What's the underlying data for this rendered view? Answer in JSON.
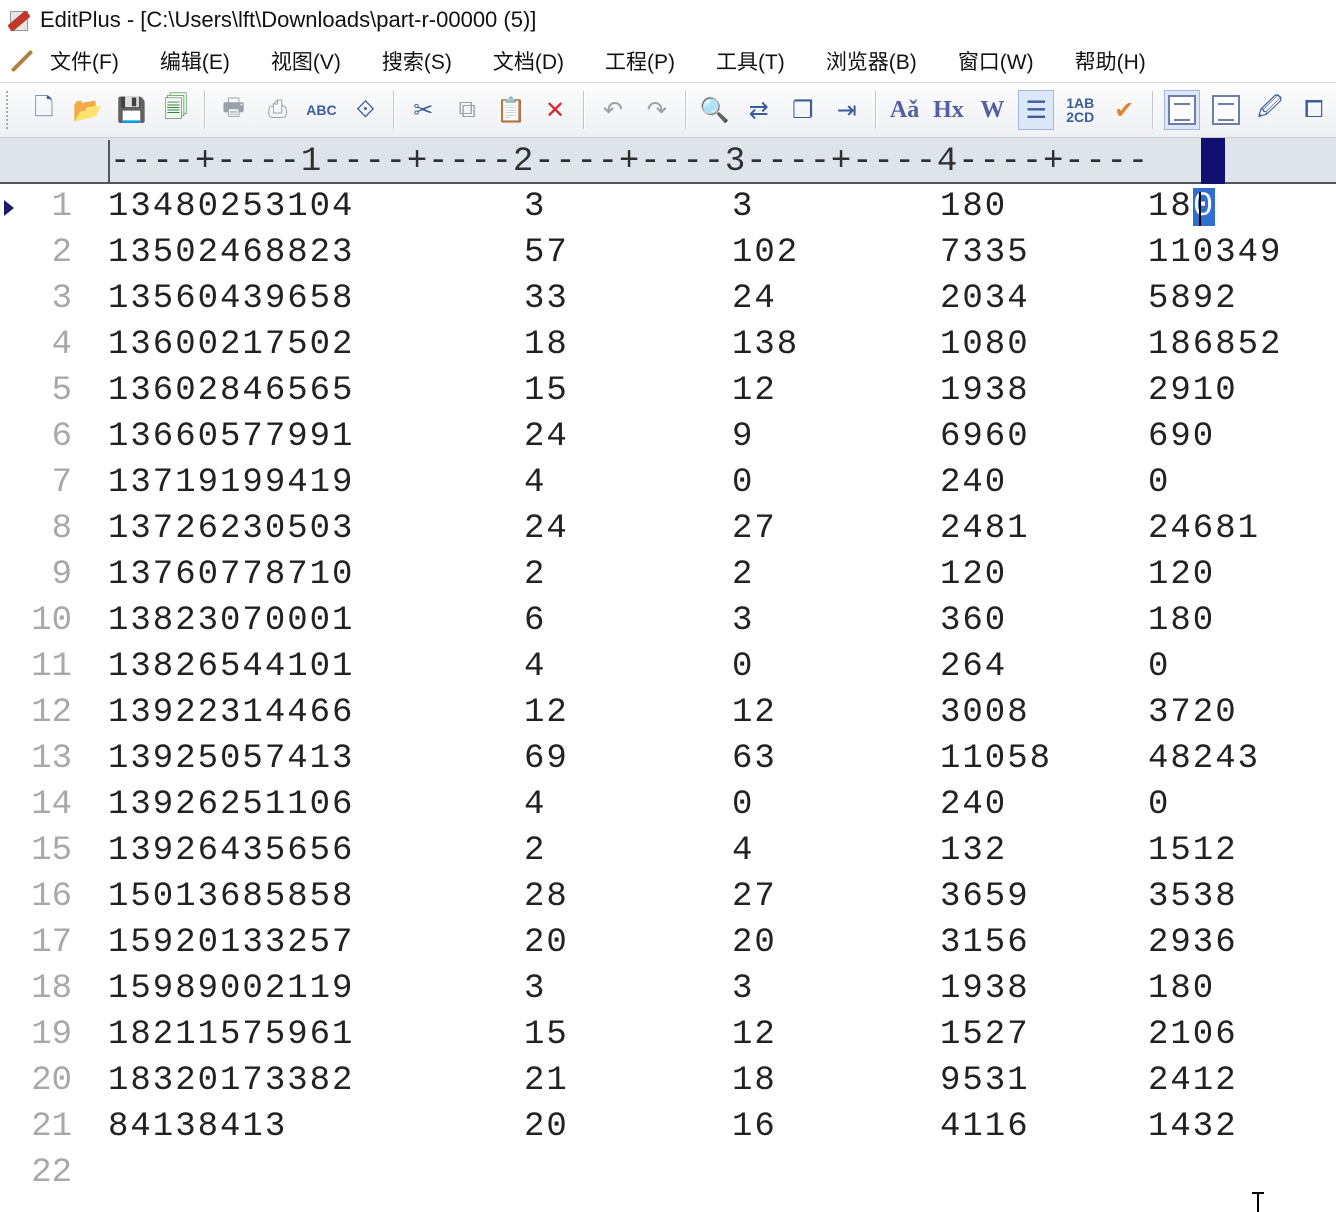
{
  "window": {
    "title": "EditPlus - [C:\\Users\\lft\\Downloads\\part-r-00000 (5)]"
  },
  "menu": {
    "items": [
      "文件(F)",
      "编辑(E)",
      "视图(V)",
      "搜索(S)",
      "文档(D)",
      "工程(P)",
      "工具(T)",
      "浏览器(B)",
      "窗口(W)",
      "帮助(H)"
    ]
  },
  "toolbar": {
    "spell_label": "ABC",
    "font_label": "Aǎ",
    "hex_label": "Hx",
    "word_label": "W",
    "col_label": "1AB\n2CD"
  },
  "ruler": {
    "text": "----+----1----+----2----+----3----+----4----+----"
  },
  "editor": {
    "rows": [
      {
        "num": "1",
        "cols": [
          "13480253104",
          "3",
          "3",
          "180",
          "180"
        ]
      },
      {
        "num": "2",
        "cols": [
          "13502468823",
          "57",
          "102",
          "7335",
          "110349"
        ]
      },
      {
        "num": "3",
        "cols": [
          "13560439658",
          "33",
          "24",
          "2034",
          "5892"
        ]
      },
      {
        "num": "4",
        "cols": [
          "13600217502",
          "18",
          "138",
          "1080",
          "186852"
        ]
      },
      {
        "num": "5",
        "cols": [
          "13602846565",
          "15",
          "12",
          "1938",
          "2910"
        ]
      },
      {
        "num": "6",
        "cols": [
          "13660577991",
          "24",
          "9",
          "6960",
          "690"
        ]
      },
      {
        "num": "7",
        "cols": [
          "13719199419",
          "4",
          "0",
          "240",
          "0"
        ]
      },
      {
        "num": "8",
        "cols": [
          "13726230503",
          "24",
          "27",
          "2481",
          "24681"
        ]
      },
      {
        "num": "9",
        "cols": [
          "13760778710",
          "2",
          "2",
          "120",
          "120"
        ]
      },
      {
        "num": "10",
        "cols": [
          "13823070001",
          "6",
          "3",
          "360",
          "180"
        ]
      },
      {
        "num": "11",
        "cols": [
          "13826544101",
          "4",
          "0",
          "264",
          "0"
        ]
      },
      {
        "num": "12",
        "cols": [
          "13922314466",
          "12",
          "12",
          "3008",
          "3720"
        ]
      },
      {
        "num": "13",
        "cols": [
          "13925057413",
          "69",
          "63",
          "11058",
          "48243"
        ]
      },
      {
        "num": "14",
        "cols": [
          "13926251106",
          "4",
          "0",
          "240",
          "0"
        ]
      },
      {
        "num": "15",
        "cols": [
          "13926435656",
          "2",
          "4",
          "132",
          "1512"
        ]
      },
      {
        "num": "16",
        "cols": [
          "15013685858",
          "28",
          "27",
          "3659",
          "3538"
        ]
      },
      {
        "num": "17",
        "cols": [
          "15920133257",
          "20",
          "20",
          "3156",
          "2936"
        ]
      },
      {
        "num": "18",
        "cols": [
          "15989002119",
          "3",
          "3",
          "1938",
          "180"
        ]
      },
      {
        "num": "19",
        "cols": [
          "18211575961",
          "15",
          "12",
          "1527",
          "2106"
        ]
      },
      {
        "num": "20",
        "cols": [
          "18320173382",
          "21",
          "18",
          "9531",
          "2412"
        ]
      },
      {
        "num": "21",
        "cols": [
          "84138413",
          "20",
          "16",
          "4116",
          "1432"
        ]
      },
      {
        "num": "22",
        "cols": [
          "",
          "",
          "",
          "",
          ""
        ]
      }
    ]
  }
}
